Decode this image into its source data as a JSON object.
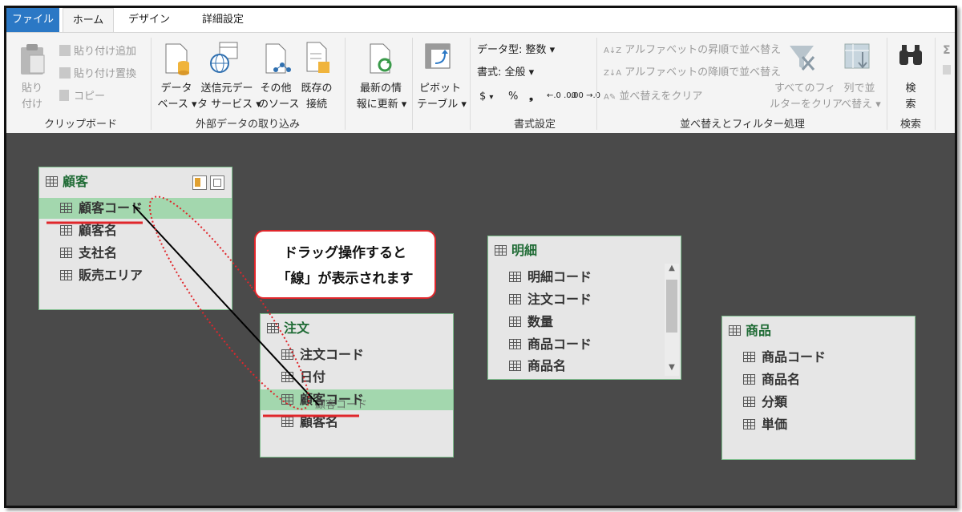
{
  "tabs": [
    "ファイル",
    "ホーム",
    "デザイン",
    "詳細設定"
  ],
  "clipboard": {
    "paste": [
      "貼り",
      "付け"
    ],
    "append": "貼り付け追加",
    "replace": "貼り付け置換",
    "copy": "コピー",
    "group": "クリップボード"
  },
  "external": {
    "database": [
      "データ",
      "ベース"
    ],
    "service": [
      "送信元デー",
      "タ サービス"
    ],
    "other": [
      "その他",
      "のソース"
    ],
    "existing": [
      "既存の",
      "接続"
    ],
    "group": "外部データの取り込み"
  },
  "refresh": [
    "最新の情",
    "報に更新"
  ],
  "pivot": [
    "ピボット",
    "テーブル"
  ],
  "format": {
    "datatype": "データ型: 整数",
    "style": "書式: 全般",
    "currency": "$",
    "percent": "%",
    "comma": "❟",
    "inc": "←.0 .00",
    "dec": ".00 →.0",
    "group": "書式設定"
  },
  "sort": {
    "asc": "アルファベットの昇順で並べ替え",
    "desc": "アルファベットの降順で並べ替え",
    "clear": "並べ替えをクリア",
    "clear_filter": [
      "すべてのフィ",
      "ルターをクリア"
    ],
    "sort_by_col": [
      "列で並",
      "べ替え"
    ],
    "group": "並べ替えとフィルター処理"
  },
  "search": {
    "label": [
      "検",
      "索"
    ],
    "group": "検索"
  },
  "tables": {
    "customer": {
      "title": "顧客",
      "fields": [
        "顧客コード",
        "顧客名",
        "支社名",
        "販売エリア"
      ]
    },
    "order": {
      "title": "注文",
      "fields": [
        "注文コード",
        "日付",
        "顧客コード",
        "顧客名"
      ]
    },
    "detail": {
      "title": "明細",
      "fields": [
        "明細コード",
        "注文コード",
        "数量",
        "商品コード",
        "商品名"
      ]
    },
    "product": {
      "title": "商品",
      "fields": [
        "商品コード",
        "商品名",
        "分類",
        "単価"
      ]
    }
  },
  "callout": [
    "ドラッグ操作すると",
    "「線」が表示されます"
  ],
  "drag_ghost": "顧客コード",
  "colors": {
    "accent": "#2b78c5",
    "table_title": "#1f6b35",
    "highlight": "#a3d7ae",
    "annotation": "#e0262b",
    "canvas": "#4a4a4a"
  }
}
